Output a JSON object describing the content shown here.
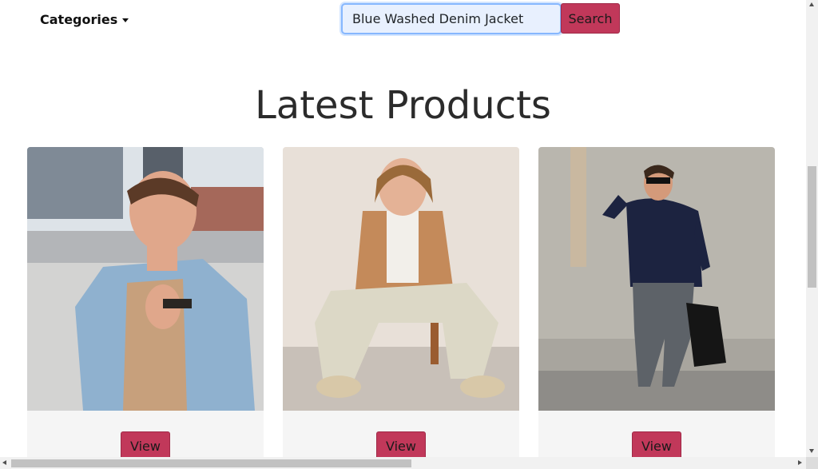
{
  "navbar": {
    "categories_label": "Categories",
    "search_value": "Blue Washed Denim Jacket",
    "search_button_label": "Search"
  },
  "main": {
    "title": "Latest Products",
    "products": [
      {
        "image_icon": "product-photo-denim-jacket-man",
        "button_label": "View"
      },
      {
        "image_icon": "product-photo-tan-blazer-seated-man",
        "button_label": "View"
      },
      {
        "image_icon": "product-photo-navy-sweater-man-backpack",
        "button_label": "View"
      }
    ]
  },
  "colors": {
    "accent_button": "#c1385a",
    "card_background": "#f5f5f5",
    "search_field_background": "#e8f0fe"
  }
}
